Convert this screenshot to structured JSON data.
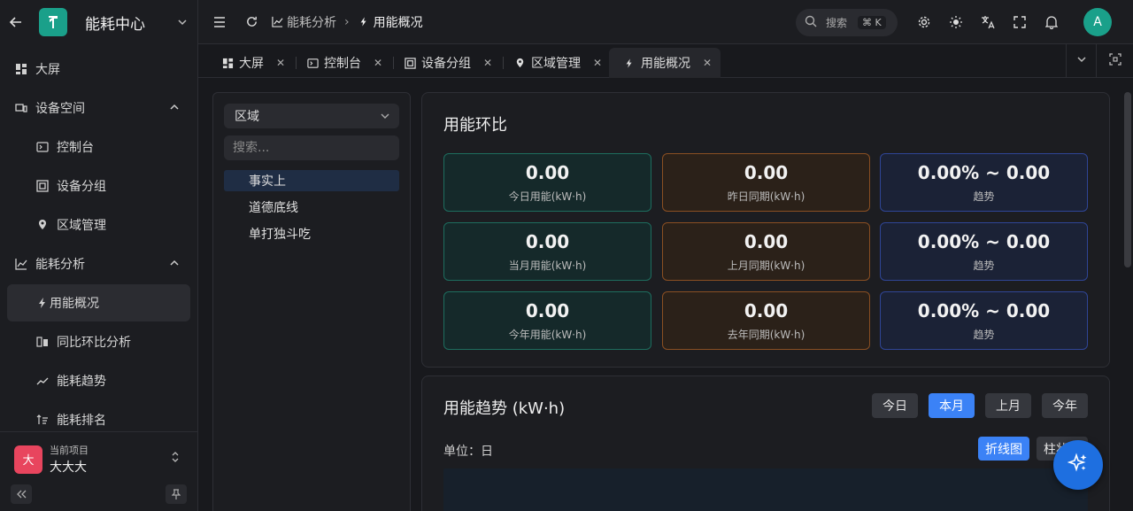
{
  "app": {
    "name": "能耗中心"
  },
  "sidebar": {
    "items": [
      {
        "label": "大屏"
      },
      {
        "label": "设备空间"
      },
      {
        "label": "控制台"
      },
      {
        "label": "设备分组"
      },
      {
        "label": "区域管理"
      },
      {
        "label": "能耗分析"
      },
      {
        "label": "用能概况"
      },
      {
        "label": "同比环比分析"
      },
      {
        "label": "能耗趋势"
      },
      {
        "label": "能耗排名"
      }
    ],
    "project_caption": "当前项目",
    "project_name": "大大大",
    "project_avatar": "大"
  },
  "header": {
    "breadcrumb": [
      "能耗分析",
      "用能概况"
    ],
    "search_label": "搜索",
    "search_shortcut": "⌘ K",
    "user_initial": "A"
  },
  "tabs": [
    {
      "label": "大屏"
    },
    {
      "label": "控制台"
    },
    {
      "label": "设备分组"
    },
    {
      "label": "区域管理"
    },
    {
      "label": "用能概况"
    }
  ],
  "tree": {
    "select_value": "区域",
    "search_placeholder": "搜索...",
    "items": [
      "事实上",
      "道德底线",
      "单打独斗吃"
    ]
  },
  "compare": {
    "title": "用能环比",
    "cells": [
      {
        "value": "0.00",
        "label": "今日用能(kW·h)"
      },
      {
        "value": "0.00",
        "label": "昨日同期(kW·h)"
      },
      {
        "value": "0.00% ~ 0.00",
        "label": "趋势"
      },
      {
        "value": "0.00",
        "label": "当月用能(kW·h)"
      },
      {
        "value": "0.00",
        "label": "上月同期(kW·h)"
      },
      {
        "value": "0.00% ~ 0.00",
        "label": "趋势"
      },
      {
        "value": "0.00",
        "label": "今年用能(kW·h)"
      },
      {
        "value": "0.00",
        "label": "去年同期(kW·h)"
      },
      {
        "value": "0.00% ~ 0.00",
        "label": "趋势"
      }
    ]
  },
  "trend": {
    "title": "用能趋势 (kW·h)",
    "ranges": [
      "今日",
      "本月",
      "上月",
      "今年"
    ],
    "active_range": "本月",
    "unit_label": "单位：日",
    "chart_types": [
      "折线图",
      "柱状图"
    ],
    "active_chart_type": "折线图"
  },
  "colors": {
    "accent": "#3b82f6",
    "brand": "#1aa08a"
  }
}
